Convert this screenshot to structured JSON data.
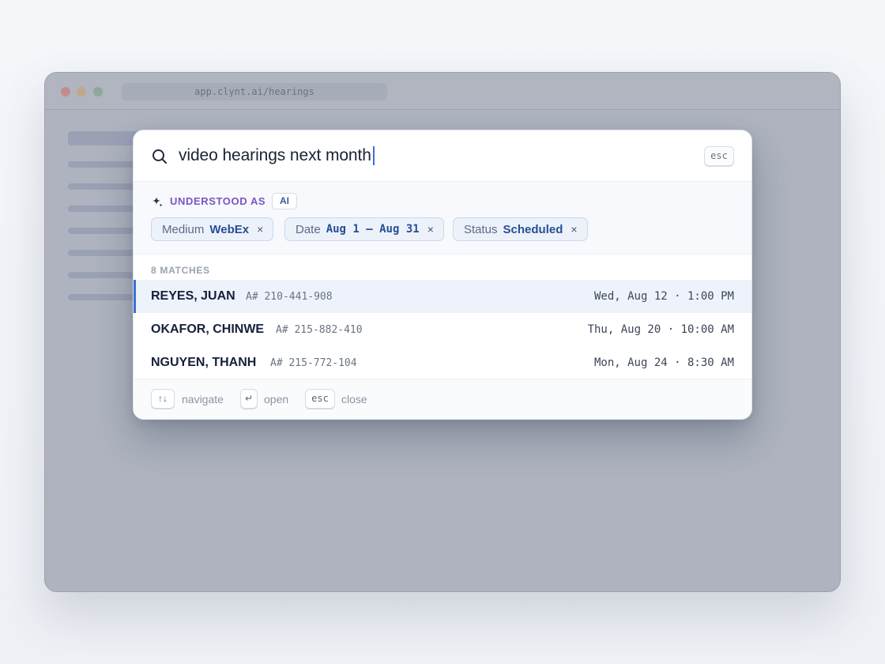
{
  "browser": {
    "url": "app.clynt.ai/hearings"
  },
  "search": {
    "query": "video hearings next month",
    "esc_label": "esc"
  },
  "understood": {
    "label": "UNDERSTOOD AS",
    "badge": "AI",
    "chips": [
      {
        "key": "Medium",
        "value": "WebEx",
        "remove": "×"
      },
      {
        "key": "Date",
        "value": "Aug 1 – Aug 31",
        "remove": "×"
      },
      {
        "key": "Status",
        "value": "Scheduled",
        "remove": "×"
      }
    ]
  },
  "results": {
    "count_label": "8 MATCHES",
    "rows": [
      {
        "name": "REYES, JUAN",
        "a_number": "A# 210-441-908",
        "when": "Wed, Aug 12 · 1:00 PM",
        "selected": true
      },
      {
        "name": "OKAFOR, CHINWE",
        "a_number": "A# 215-882-410",
        "when": "Thu, Aug 20 · 10:00 AM",
        "selected": false
      },
      {
        "name": "NGUYEN, THANH",
        "a_number": "A# 215-772-104",
        "when": "Mon, Aug 24 · 8:30 AM",
        "selected": false
      }
    ]
  },
  "footer": {
    "hints": [
      {
        "key": "↑↓",
        "label": "navigate"
      },
      {
        "key": "↵",
        "label": "open"
      },
      {
        "key": "esc",
        "label": "close"
      }
    ]
  },
  "colors": {
    "accent": "#3b6fd6",
    "ai_purple": "#7a56c4",
    "chip_value": "#274e96"
  }
}
